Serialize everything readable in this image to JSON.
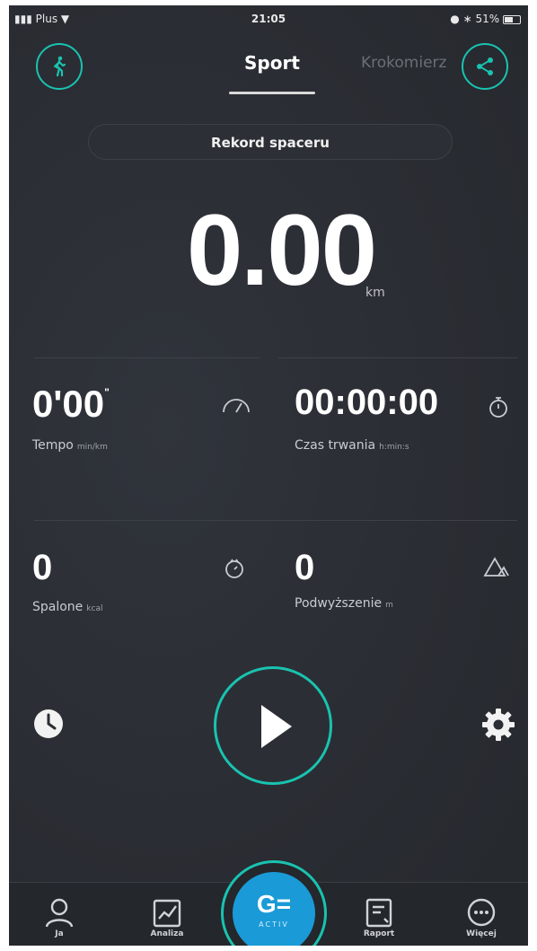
{
  "status_bar": {
    "carrier": "Plus",
    "time": "21:05",
    "battery": "51%"
  },
  "header": {
    "tabs": [
      {
        "label": "Sport",
        "active": true
      },
      {
        "label": "Krokomierz",
        "active": false
      }
    ],
    "left_icon": "walker-icon",
    "right_icon": "share-icon"
  },
  "record_button": {
    "label": "Rekord spaceru"
  },
  "distance": {
    "value": "0.00",
    "unit": "km"
  },
  "stats": [
    {
      "value": "0'00",
      "suffix": "\"",
      "label": "Tempo",
      "unit": "min/km",
      "icon": "speedometer-icon"
    },
    {
      "value": "00:00:00",
      "suffix": "",
      "label": "Czas trwania",
      "unit": "h:min:s",
      "icon": "stopwatch-icon"
    },
    {
      "value": "0",
      "suffix": "",
      "label": "Spalone",
      "unit": "kcal",
      "icon": "calorie-icon"
    },
    {
      "value": "0",
      "suffix": "",
      "label": "Podwyższenie",
      "unit": "m",
      "icon": "elevation-icon"
    }
  ],
  "controls": {
    "history_icon": "clock-icon",
    "play_icon": "play-icon",
    "settings_icon": "gear-icon"
  },
  "bottom_nav": {
    "items": [
      {
        "label": "Ja",
        "icon": "user-icon"
      },
      {
        "label": "Analiza",
        "icon": "chart-icon"
      },
      {
        "label": "Raport",
        "icon": "report-icon"
      },
      {
        "label": "Więcej",
        "icon": "more-icon"
      }
    ],
    "center": {
      "logo": "G=",
      "sub": "ACTIV"
    }
  },
  "colors": {
    "accent": "#19c3b0",
    "background": "#2a2d33",
    "center_blue": "#1a9ad6"
  }
}
